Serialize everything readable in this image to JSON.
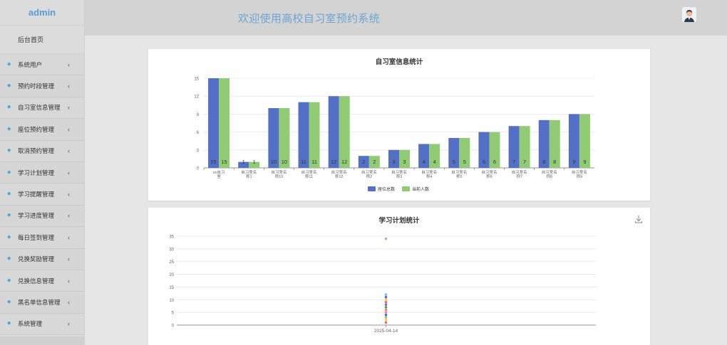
{
  "sidebar": {
    "brand": "admin",
    "home": "后台首页",
    "items": [
      {
        "label": "系统用户"
      },
      {
        "label": "预约时段管理"
      },
      {
        "label": "自习室信息管理"
      },
      {
        "label": "座位预约管理"
      },
      {
        "label": "取消预约管理"
      },
      {
        "label": "学习计划管理"
      },
      {
        "label": "学习提醒管理"
      },
      {
        "label": "学习进度管理"
      },
      {
        "label": "每日签到管理"
      },
      {
        "label": "兑换奖励管理"
      },
      {
        "label": "兑换信息管理"
      },
      {
        "label": "黑名单信息管理"
      },
      {
        "label": "系统管理"
      }
    ],
    "chevron": "‹"
  },
  "header": {
    "title": "欢迎使用高校自习室预约系统"
  },
  "colors": {
    "series1": "#5470c6",
    "series2": "#91cc75",
    "accent": "#6aa6d1"
  },
  "chart_data": [
    {
      "type": "bar",
      "title": "自习室信息统计",
      "categories": [
        "xx自习室",
        "自习室名称1",
        "自习室名称10",
        "自习室名称11",
        "自习室名称12",
        "自习室名称2",
        "自习室名称3",
        "自习室名称4",
        "自习室名称5",
        "自习室名称6",
        "自习室名称7",
        "自习室名称8",
        "自习室名称9"
      ],
      "category_lines": [
        [
          "xx自习",
          "室"
        ],
        [
          "自习室名",
          "称1"
        ],
        [
          "自习室名",
          "称10"
        ],
        [
          "自习室名",
          "称11"
        ],
        [
          "自习室名",
          "称12"
        ],
        [
          "自习室名",
          "称2"
        ],
        [
          "自习室名",
          "称3"
        ],
        [
          "自习室名",
          "称4"
        ],
        [
          "自习室名",
          "称5"
        ],
        [
          "自习室名",
          "称6"
        ],
        [
          "自习室名",
          "称7"
        ],
        [
          "自习室名",
          "称8"
        ],
        [
          "自习室名",
          "称9"
        ]
      ],
      "series": [
        {
          "name": "座位总数",
          "values": [
            15,
            1,
            10,
            11,
            12,
            2,
            3,
            4,
            5,
            6,
            7,
            8,
            9
          ]
        },
        {
          "name": "当前人数",
          "values": [
            15,
            1,
            10,
            11,
            12,
            2,
            3,
            4,
            5,
            6,
            7,
            8,
            9
          ]
        }
      ],
      "ylim": [
        0,
        15
      ],
      "yticks": [
        0,
        3,
        6,
        9,
        12,
        15
      ],
      "grid": true,
      "legend": "bottom-center"
    },
    {
      "type": "scatter",
      "title": "学习计划统计",
      "x": [
        "2025-04-14"
      ],
      "x_label_text": "2025-04-14",
      "points": [
        {
          "x": "2025-04-14",
          "y": 34
        },
        {
          "x": "2025-04-14",
          "y": 12
        },
        {
          "x": "2025-04-14",
          "y": 11
        },
        {
          "x": "2025-04-14",
          "y": 10
        },
        {
          "x": "2025-04-14",
          "y": 9
        },
        {
          "x": "2025-04-14",
          "y": 8
        },
        {
          "x": "2025-04-14",
          "y": 7
        },
        {
          "x": "2025-04-14",
          "y": 6
        },
        {
          "x": "2025-04-14",
          "y": 5
        },
        {
          "x": "2025-04-14",
          "y": 4
        },
        {
          "x": "2025-04-14",
          "y": 3
        },
        {
          "x": "2025-04-14",
          "y": 2
        },
        {
          "x": "2025-04-14",
          "y": 1
        }
      ],
      "point_colors": [
        "#91cc75",
        "#73c0de",
        "#5470c6",
        "#fac858",
        "#ee6666",
        "#9a60b4",
        "#3ba272",
        "#fc8452",
        "#ea7ccc",
        "#5470c6",
        "#91cc75",
        "#fac858",
        "#ee6666"
      ],
      "ylim": [
        0,
        35
      ],
      "yticks": [
        0,
        5,
        10,
        15,
        20,
        25,
        30,
        35
      ],
      "grid": true
    }
  ]
}
